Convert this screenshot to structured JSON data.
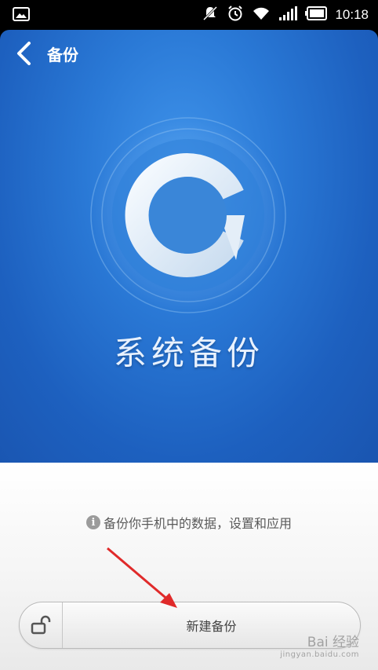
{
  "status_bar": {
    "time": "10:18",
    "icons": [
      "image-icon",
      "silent-icon",
      "alarm-icon",
      "wifi-icon",
      "signal-icon",
      "battery-icon"
    ]
  },
  "header": {
    "title": "备份"
  },
  "hero": {
    "label": "系统备份",
    "colors": {
      "top": "#3f93ea",
      "bottom": "#1a55b0"
    }
  },
  "info": {
    "icon_glyph": "i",
    "text": "备份你手机中的数据，设置和应用"
  },
  "actions": {
    "new_backup_label": "新建备份"
  },
  "watermark": {
    "top": "Bai 经验",
    "bottom": "jingyan.baidu.com"
  }
}
